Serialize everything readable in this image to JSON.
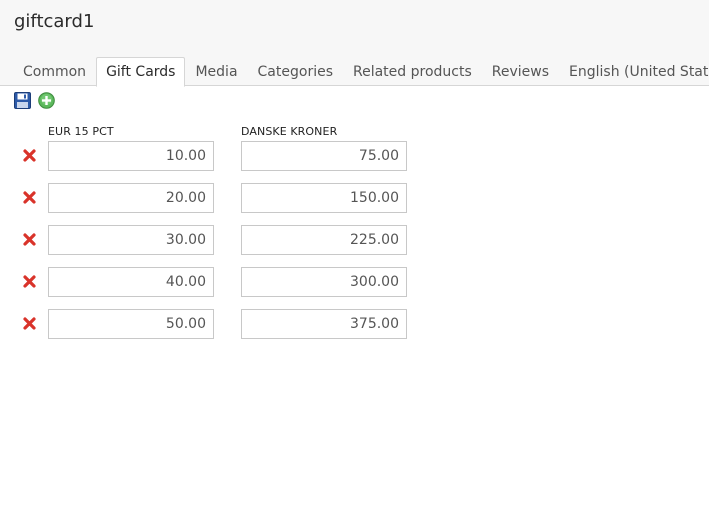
{
  "product": {
    "title": "giftcard1"
  },
  "tabs": [
    {
      "label": "Common",
      "active": false
    },
    {
      "label": "Gift Cards",
      "active": true
    },
    {
      "label": "Media",
      "active": false
    },
    {
      "label": "Categories",
      "active": false
    },
    {
      "label": "Related products",
      "active": false
    },
    {
      "label": "Reviews",
      "active": false
    },
    {
      "label": "English (United States)",
      "active": false
    }
  ],
  "toolbar": {
    "save_icon": "floppy-disk-icon",
    "add_icon": "green-plus-circle-icon"
  },
  "table": {
    "columns": [
      "EUR 15 PCT",
      "DANSKE KRONER"
    ],
    "rows": [
      {
        "eur": "10.00",
        "dkk": "75.00"
      },
      {
        "eur": "20.00",
        "dkk": "150.00"
      },
      {
        "eur": "30.00",
        "dkk": "225.00"
      },
      {
        "eur": "40.00",
        "dkk": "300.00"
      },
      {
        "eur": "50.00",
        "dkk": "375.00"
      }
    ],
    "delete_icon": "red-x-icon"
  },
  "colors": {
    "header_bg": "#f7f7f7",
    "border": "#d6d6d6",
    "delete_red": "#d9332a",
    "add_green": "#5cb85c",
    "save_blue": "#2d5aa8"
  }
}
